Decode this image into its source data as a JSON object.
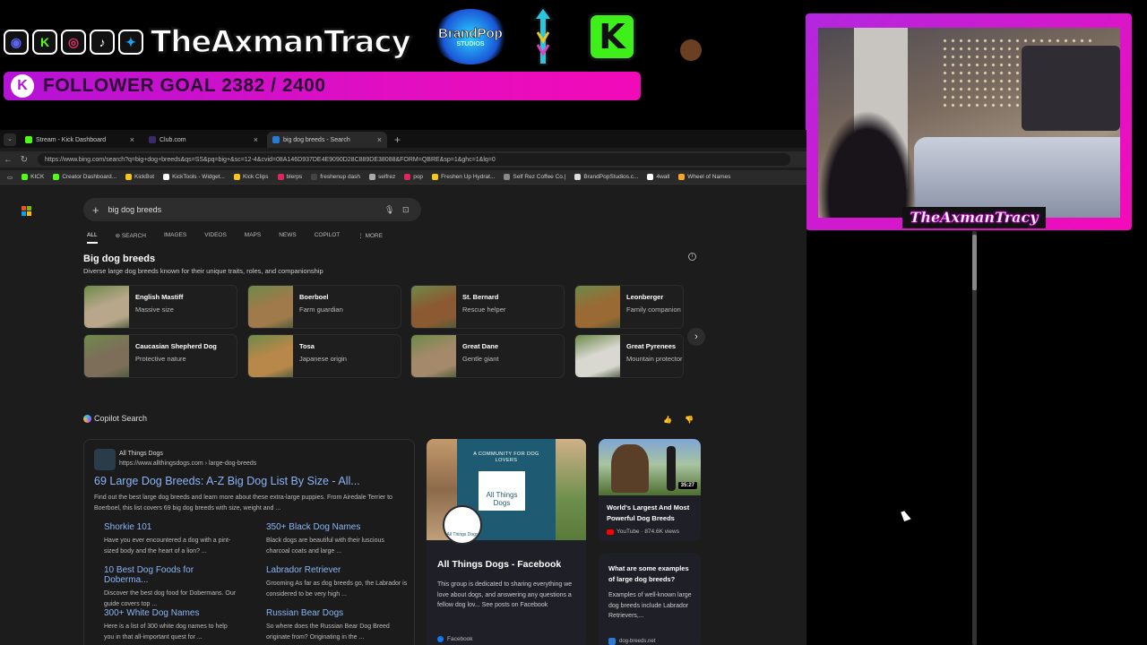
{
  "overlay": {
    "social_icons": [
      {
        "icon": "discord-icon",
        "glyph": "◉",
        "color": "#5865f2"
      },
      {
        "icon": "kick-icon",
        "glyph": "K",
        "color": "#53fc18"
      },
      {
        "icon": "instagram-icon",
        "glyph": "◎",
        "color": "#e1306c"
      },
      {
        "icon": "tiktok-icon",
        "glyph": "♪",
        "color": "#ffffff"
      },
      {
        "icon": "twitter-icon",
        "glyph": "✦",
        "color": "#1da1f2"
      }
    ],
    "handle": "TheAxmanTracy",
    "brandpop": {
      "line1": "BrandPop",
      "line2": "STUDIOS"
    },
    "kick_logo": "K",
    "goal": {
      "k": "K",
      "text": "FOLLOWER GOAL 2382 / 2400",
      "current": 2382,
      "target": 2400
    },
    "cam_name": "TheAxmanTracy"
  },
  "browser": {
    "tabs": [
      {
        "label": "Stream - Kick Dashboard",
        "fav": "#53fc18",
        "active": false
      },
      {
        "label": "Club.com",
        "fav": "#3a2a6a",
        "active": false
      },
      {
        "label": "big dog breeds - Search",
        "fav": "#2a7ad6",
        "active": true
      }
    ],
    "new_tab": "+",
    "url": "https://www.bing.com/search?q=big+dog+breeds&qs=SS&pq=big+&sc=12-4&cvid=08A146D937DE4E9090D28C889DE38088&FORM=QBRE&sp=1&ghc=1&lq=0",
    "bookmarks": [
      {
        "label": "KICK",
        "fav": "#53fc18"
      },
      {
        "label": "Creator Dashboard...",
        "fav": "#53fc18"
      },
      {
        "label": "KickBot",
        "fav": "#f5c518"
      },
      {
        "label": "KickTools - Widget...",
        "fav": "#ffffff"
      },
      {
        "label": "Kick Clips",
        "fav": "#f5c518"
      },
      {
        "label": "blerps",
        "fav": "#e0245e"
      },
      {
        "label": "freshenup dash",
        "fav": "#444"
      },
      {
        "label": "selfrez",
        "fav": "#aaa"
      },
      {
        "label": "pop",
        "fav": "#e0245e"
      },
      {
        "label": "Freshen Up Hydrat...",
        "fav": "#f5c518"
      },
      {
        "label": "Self Rez Coffee Co.|",
        "fav": "#888"
      },
      {
        "label": "BrandPopStudios.c...",
        "fav": "#ddd"
      },
      {
        "label": "4wall",
        "fav": "#fff"
      },
      {
        "label": "Wheel of Names",
        "fav": "#f5a623"
      }
    ]
  },
  "page": {
    "query": "big dog breeds",
    "nav": [
      "ALL",
      "SEARCH",
      "IMAGES",
      "VIDEOS",
      "MAPS",
      "NEWS",
      "COPILOT",
      "MORE"
    ],
    "section_title": "Big dog breeds",
    "section_subtitle": "Diverse large dog breeds known for their unique traits, roles, and companionship",
    "breeds": [
      {
        "name": "English Mastiff",
        "desc": "Massive size",
        "color": "#b8a78a"
      },
      {
        "name": "Boerboel",
        "desc": "Farm guardian",
        "color": "#a07a4a"
      },
      {
        "name": "St. Bernard",
        "desc": "Rescue helper",
        "color": "#8b5a32"
      },
      {
        "name": "Leonberger",
        "desc": "Family companion",
        "color": "#9a6a34"
      },
      {
        "name": "Caucasian Shepherd Dog",
        "desc": "Protective nature",
        "color": "#7d6e5a"
      },
      {
        "name": "Tosa",
        "desc": "Japanese origin",
        "color": "#b8884a"
      },
      {
        "name": "Great Dane",
        "desc": "Gentle giant",
        "color": "#a48a6a"
      },
      {
        "name": "Great Pyrenees",
        "desc": "Mountain protector",
        "color": "#d8d8d0"
      }
    ],
    "copilot_label": "Copilot Search",
    "result": {
      "site": "All Things Dogs",
      "url": "https://www.allthingsdogs.com › large-dog-breeds",
      "title": "69 Large Dog Breeds: A-Z Big Dog List By Size - All...",
      "desc": "Find out the best large dog breeds and learn more about these extra-large puppies. From Airedale Terrier to Boerboel, this list covers 69 big dog breeds with size, weight and ...",
      "sublinks": [
        {
          "title": "Shorkie 101",
          "desc": "Have you ever encountered a dog with a pint-sized body and the heart of a lion? ..."
        },
        {
          "title": "350+ Black Dog Names",
          "desc": "Black dogs are beautiful with their luscious charcoal coats and large ..."
        },
        {
          "title": "10 Best Dog Foods for Doberma...",
          "desc": "Discover the best dog food for Dobermans. Our guide covers top ..."
        },
        {
          "title": "Labrador Retriever",
          "desc": "Grooming As far as dog breeds go, the Labrador is considered to be very high ..."
        },
        {
          "title": "300+ White Dog Names",
          "desc": "Here is a list of 300 white dog names to help you in that all-important quest for ..."
        },
        {
          "title": "Russian Bear Dogs",
          "desc": "So where does the Russian Bear Dog Breed originate from? Originating in the ..."
        }
      ]
    },
    "fb_card": {
      "community": "A COMMUNITY FOR DOG LOVERS",
      "logo": "All Things Dogs",
      "circle": "All Things Dogs",
      "title": "All Things Dogs - Facebook",
      "desc": "This group is dedicated to sharing everything we love about dogs, and answering any questions a fellow dog lov... See posts on Facebook",
      "source": "Facebook"
    },
    "video_card": {
      "duration": "35:27",
      "title": "World's Largest And Most Powerful Dog Breeds",
      "source": "YouTube · 874.6K views"
    },
    "q_card": {
      "title": "What are some examples of large dog breeds?",
      "desc": "Examples of well-known large dog breeds include Labrador Retrievers,...",
      "source": "dog-breeds.net"
    }
  }
}
